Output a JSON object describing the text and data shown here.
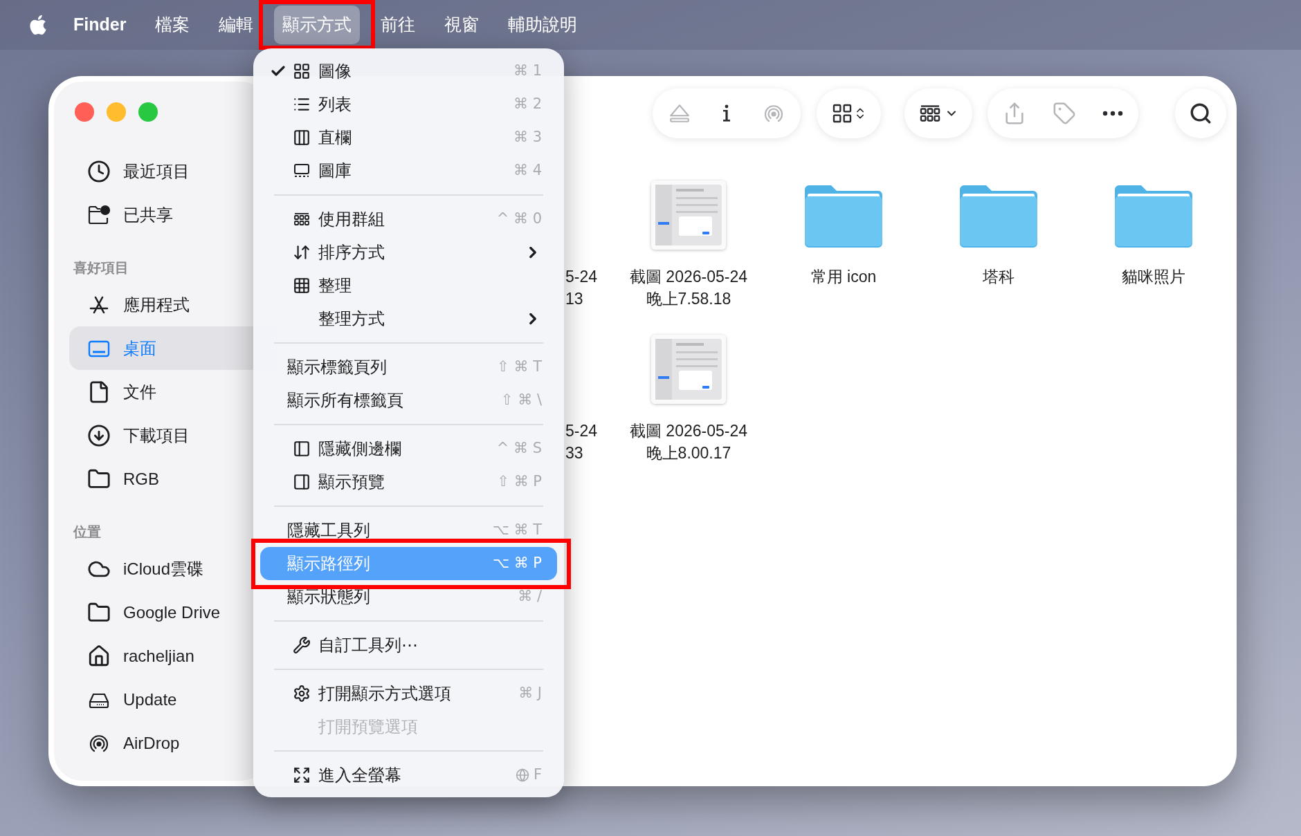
{
  "menu_bar": {
    "app": "Finder",
    "menus": [
      {
        "label": "檔案",
        "selected": false
      },
      {
        "label": "編輯",
        "selected": false
      },
      {
        "label": "顯示方式",
        "selected": true,
        "annotated": true
      },
      {
        "label": "前往",
        "selected": false
      },
      {
        "label": "視窗",
        "selected": false
      },
      {
        "label": "輔助說明",
        "selected": false
      }
    ]
  },
  "view_menu": {
    "groups": [
      [
        {
          "label": "圖像",
          "shortcut": "⌘ 1",
          "checked": true,
          "selected": false,
          "disabled": false
        },
        {
          "label": "列表",
          "shortcut": "⌘ 2",
          "checked": false,
          "selected": false,
          "disabled": false
        },
        {
          "label": "直欄",
          "shortcut": "⌘ 3",
          "checked": false,
          "selected": false,
          "disabled": false
        },
        {
          "label": "圖庫",
          "shortcut": "⌘ 4",
          "checked": false,
          "selected": false,
          "disabled": false
        }
      ],
      [
        {
          "label": "使用群組",
          "shortcut": "^ ⌘ 0",
          "checked": false,
          "selected": false,
          "disabled": false
        },
        {
          "label": "排序方式",
          "submenu": true,
          "checked": false,
          "selected": false,
          "disabled": false
        },
        {
          "label": "整理",
          "checked": false,
          "selected": false,
          "disabled": false
        },
        {
          "label": "整理方式",
          "submenu": true,
          "checked": false,
          "selected": false,
          "disabled": false
        }
      ],
      [
        {
          "label": "顯示標籤頁列",
          "shortcut": "⇧ ⌘ T",
          "checked": false,
          "selected": false,
          "disabled": false
        },
        {
          "label": "顯示所有標籤頁",
          "shortcut": "⇧ ⌘ \\",
          "checked": false,
          "selected": false,
          "disabled": false
        }
      ],
      [
        {
          "label": "隱藏側邊欄",
          "shortcut": "^ ⌘ S",
          "checked": false,
          "selected": false,
          "disabled": false
        },
        {
          "label": "顯示預覽",
          "shortcut": "⇧ ⌘ P",
          "checked": false,
          "selected": false,
          "disabled": false
        }
      ],
      [
        {
          "label": "隱藏工具列",
          "shortcut": "⌥ ⌘ T",
          "checked": false,
          "selected": false,
          "disabled": false
        },
        {
          "label": "顯示路徑列",
          "shortcut": "⌥ ⌘ P",
          "checked": false,
          "selected": true,
          "disabled": false,
          "annotated": true
        },
        {
          "label": "顯示狀態列",
          "shortcut": "⌘ /",
          "checked": false,
          "selected": false,
          "disabled": false
        }
      ],
      [
        {
          "label": "自訂工具列⋯",
          "checked": false,
          "selected": false,
          "disabled": false
        }
      ],
      [
        {
          "label": "打開顯示方式選項",
          "shortcut": "⌘ J",
          "checked": false,
          "selected": false,
          "disabled": false
        },
        {
          "label": "打開預覽選項",
          "checked": false,
          "selected": false,
          "disabled": true
        }
      ],
      [
        {
          "label": "進入全螢幕",
          "shortcut": "F",
          "globe_key": true,
          "checked": false,
          "selected": false,
          "disabled": false
        }
      ]
    ]
  },
  "sidebar": {
    "sections": [
      {
        "items": [
          {
            "label": "最近項目",
            "selected": false
          },
          {
            "label": "已共享",
            "selected": false
          }
        ]
      },
      {
        "header": "喜好項目",
        "items": [
          {
            "label": "應用程式",
            "selected": false
          },
          {
            "label": "桌面",
            "selected": true
          },
          {
            "label": "文件",
            "selected": false
          },
          {
            "label": "下載項目",
            "selected": false
          },
          {
            "label": "RGB",
            "selected": false
          }
        ]
      },
      {
        "header": "位置",
        "items": [
          {
            "label": "iCloud雲碟",
            "selected": false
          },
          {
            "label": "Google Drive",
            "selected": false
          },
          {
            "label": "racheljian",
            "selected": false
          },
          {
            "label": "Update",
            "selected": false
          },
          {
            "label": "AirDrop",
            "selected": false
          }
        ]
      }
    ]
  },
  "toolbar_buttons": [
    {
      "disabled": true
    },
    {
      "disabled": false
    },
    {
      "disabled": true
    },
    {
      "disabled": false
    },
    {
      "disabled": false
    },
    {
      "disabled": true
    },
    {
      "disabled": true
    },
    {
      "disabled": false
    },
    {
      "disabled": false
    }
  ],
  "files": [
    {
      "kind": "partial",
      "lines": [
        "5-24",
        "13"
      ]
    },
    {
      "kind": "screenshot",
      "lines": [
        "截圖 2026-05-24",
        "晚上7.58.18"
      ]
    },
    {
      "kind": "folder",
      "lines": [
        "常用 icon"
      ]
    },
    {
      "kind": "folder",
      "lines": [
        "塔科"
      ]
    },
    {
      "kind": "folder",
      "lines": [
        "貓咪照片"
      ]
    },
    {
      "kind": "partial",
      "lines": [
        "5-24",
        "33"
      ]
    },
    {
      "kind": "screenshot",
      "lines": [
        "截圖 2026-05-24",
        "晚上8.00.17"
      ]
    }
  ]
}
